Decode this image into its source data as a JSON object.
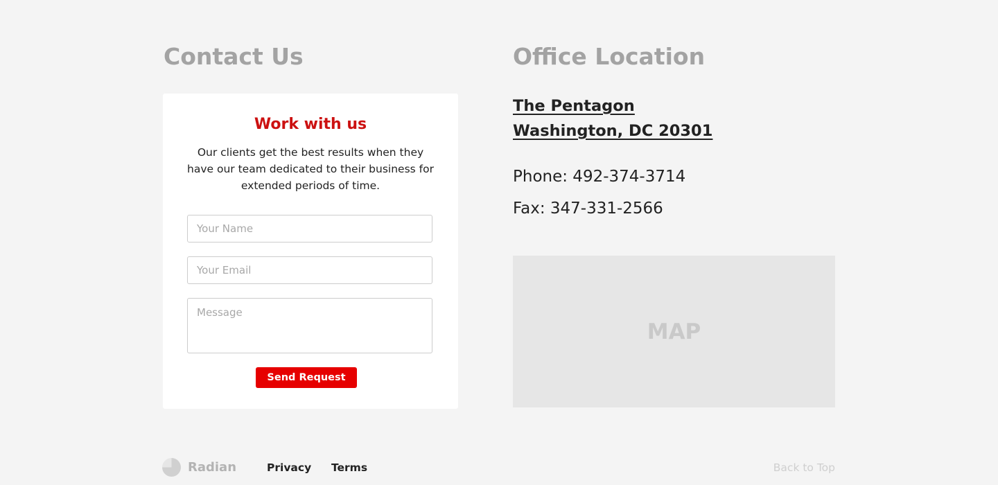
{
  "contact": {
    "title": "Contact Us",
    "card": {
      "heading": "Work with us",
      "description": "Our clients get the best results when they have our team dedicated to their business for extended periods of time.",
      "name_placeholder": "Your Name",
      "email_placeholder": "Your Email",
      "message_placeholder": "Message",
      "submit_label": "Send Request"
    }
  },
  "office": {
    "title": "Office Location",
    "address_line1": "The Pentagon",
    "address_line2": "Washington, DC 20301",
    "phone": "Phone: 492-374-3714",
    "fax": "Fax: 347-331-2566",
    "map_label": "MAP"
  },
  "footer": {
    "brand": "Radian",
    "links": [
      "Privacy",
      "Terms"
    ],
    "back_to_top": "Back to Top"
  },
  "colors": {
    "accent": "#e60000",
    "heading_red": "#cc1111",
    "section_title": "#a3a3a3",
    "background": "#f4f4f4",
    "map_background": "#e6e6e6"
  },
  "icons": {
    "logo": "radian-logo-icon"
  }
}
